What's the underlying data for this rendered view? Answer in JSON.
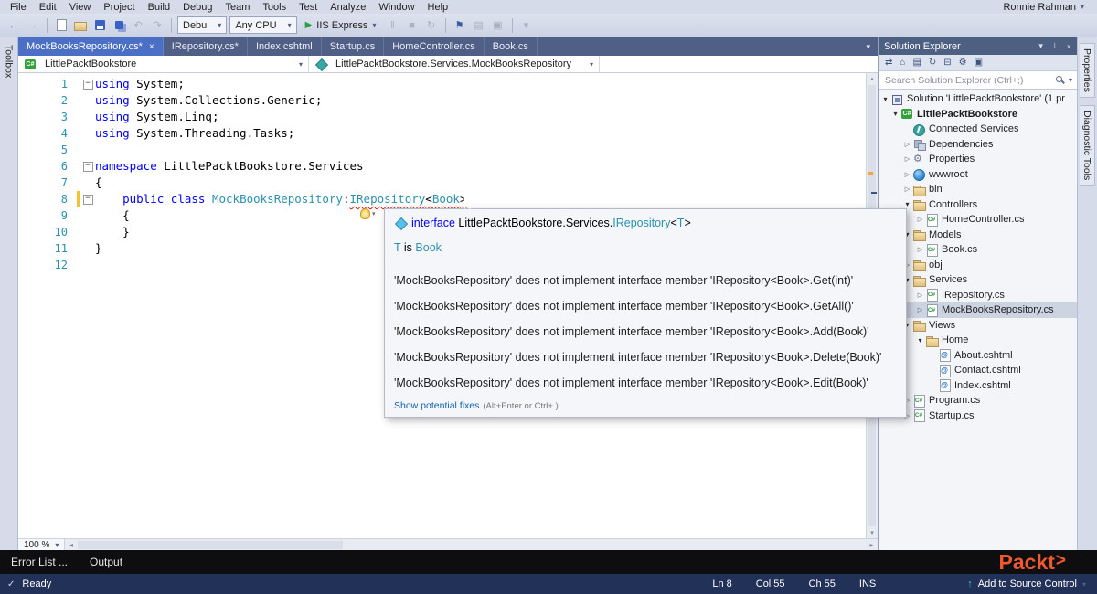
{
  "colors": {
    "chrome": "#d6dbe9",
    "strip": "#505f86",
    "tabactive": "#4a6fc4",
    "kw": "#0000ff",
    "ty": "#2b91af",
    "red": "#e51400",
    "sel": "#ccd4e2",
    "exphead": "#4d6082",
    "link": "#0e63b5",
    "status": "#223158",
    "packt": "#f0592b"
  },
  "glyphs": {
    "caret": "▾",
    "close": "×",
    "pin": "⊥",
    "back": "←",
    "fwd": "→",
    "undo": "↶",
    "redo": "↷",
    "play": "▶",
    "pause": "‖",
    "stop": "■",
    "refresh": "↻",
    "flag": "⚑",
    "home": "⌂",
    "sync": "⇄",
    "files": "▤",
    "collapse_all": "⊟",
    "gear": "⚙",
    "preview": "▣",
    "up": "↑",
    "check": "✓",
    "scroll_up": "▴",
    "scroll_down": "▾",
    "scroll_left": "◂",
    "scroll_right": "▸"
  },
  "menu": {
    "items": [
      "File",
      "Edit",
      "View",
      "Project",
      "Build",
      "Debug",
      "Team",
      "Tools",
      "Test",
      "Analyze",
      "Window",
      "Help"
    ],
    "user": "Ronnie Rahman"
  },
  "toolbar": {
    "config": "Debu",
    "platform": "Any CPU",
    "run": "IIS Express"
  },
  "tabs": [
    "MockBooksRepository.cs*",
    "IRepository.cs*",
    "Index.cshtml",
    "Startup.cs",
    "HomeController.cs",
    "Book.cs"
  ],
  "breadcrumb": {
    "left": "LittlePacktBookstore",
    "left_icon": "project",
    "right": "LittlePacktBookstore.Services.MockBooksRepository",
    "right_icon": "class"
  },
  "code": {
    "line_numbers": [
      "1",
      "2",
      "3",
      "4",
      "5",
      "6",
      "7",
      "8",
      "9",
      "10",
      "11",
      "12"
    ],
    "lines": [
      [
        "using",
        " System;"
      ],
      [
        "using",
        " System.Collections.Generic;"
      ],
      [
        "using",
        " System.Linq;"
      ],
      [
        "using",
        " System.Threading.Tasks;"
      ],
      [],
      [
        "namespace",
        " LittlePacktBookstore.Services"
      ],
      [
        "{"
      ],
      [
        "    ",
        "public",
        " ",
        "class",
        " ",
        "MockBooksRepository",
        ":",
        "IRepository",
        "<",
        "Book",
        ">"
      ],
      [
        "    {"
      ],
      [
        "    }"
      ],
      [
        "}"
      ],
      []
    ]
  },
  "editor": {
    "zoom": "100 %"
  },
  "tooltip": {
    "signature": [
      "interface",
      " LittlePacktBookstore.Services.",
      "IRepository",
      "<",
      "T",
      ">"
    ],
    "note": [
      "T",
      " is ",
      "Book"
    ],
    "errors": [
      "'MockBooksRepository' does not implement interface member 'IRepository<Book>.Get(int)'",
      "'MockBooksRepository' does not implement interface member 'IRepository<Book>.GetAll()'",
      "'MockBooksRepository' does not implement interface member 'IRepository<Book>.Add(Book)'",
      "'MockBooksRepository' does not implement interface member 'IRepository<Book>.Delete(Book)'",
      "'MockBooksRepository' does not implement interface member 'IRepository<Book>.Edit(Book)'"
    ],
    "fix_link": "Show potential fixes",
    "fix_hint": "(Alt+Enter or Ctrl+.)"
  },
  "explorer": {
    "title": "Solution Explorer",
    "search_placeholder": "Search Solution Explorer (Ctrl+;)",
    "items": [
      {
        "label": "Solution 'LittlePacktBookstore' (1 pr",
        "icon": "solution"
      },
      {
        "label": "LittlePacktBookstore",
        "icon": "project"
      },
      {
        "label": "Connected Services",
        "icon": "connected-services"
      },
      {
        "label": "Dependencies",
        "icon": "dependencies"
      },
      {
        "label": "Properties",
        "icon": "properties"
      },
      {
        "label": "wwwroot",
        "icon": "globe"
      },
      {
        "label": "bin",
        "icon": "folder"
      },
      {
        "label": "Controllers",
        "icon": "folder"
      },
      {
        "label": "HomeController.cs",
        "icon": "csharp-file"
      },
      {
        "label": "Models",
        "icon": "folder"
      },
      {
        "label": "Book.cs",
        "icon": "csharp-file"
      },
      {
        "label": "obj",
        "icon": "folder"
      },
      {
        "label": "Services",
        "icon": "folder"
      },
      {
        "label": "IRepository.cs",
        "icon": "csharp-file"
      },
      {
        "label": "MockBooksRepository.cs",
        "icon": "csharp-file"
      },
      {
        "label": "Views",
        "icon": "folder"
      },
      {
        "label": "Home",
        "icon": "folder"
      },
      {
        "label": "About.cshtml",
        "icon": "cshtml-file"
      },
      {
        "label": "Contact.cshtml",
        "icon": "cshtml-file"
      },
      {
        "label": "Index.cshtml",
        "icon": "cshtml-file"
      },
      {
        "label": "Program.cs",
        "icon": "csharp-file"
      },
      {
        "label": "Startup.cs",
        "icon": "csharp-file"
      }
    ]
  },
  "side_tabs": {
    "left": "Toolbox",
    "right": [
      "Properties",
      "Diagnostic Tools"
    ]
  },
  "bottom_tabs": [
    "Error List ...",
    "Output"
  ],
  "status": {
    "ready": "Ready",
    "ln": "Ln 8",
    "col": "Col 55",
    "ch": "Ch 55",
    "mode": "INS",
    "source_control": "Add to Source Control"
  },
  "brand": {
    "name": "Packt",
    "arrow": ">"
  }
}
